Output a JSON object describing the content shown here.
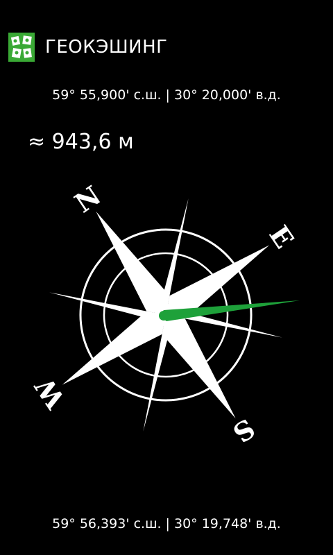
{
  "header": {
    "title": "ГЕОКЭШИНГ",
    "logo_icon": "geocaching-logo-icon",
    "brand_color": "#3aa935"
  },
  "current_position": {
    "text": "59° 55,900' с.ш. | 30° 20,000' в.д."
  },
  "distance": {
    "text": "≈ 943,6 м"
  },
  "compass": {
    "icon": "compass-rose-icon",
    "cardinals": {
      "north": "N",
      "east": "E",
      "south": "S",
      "west": "W"
    },
    "needle_color": "#1ea13a",
    "rose_color": "#ffffff"
  },
  "target_position": {
    "text": "59° 56,393' с.ш. | 30° 19,748' в.д."
  }
}
